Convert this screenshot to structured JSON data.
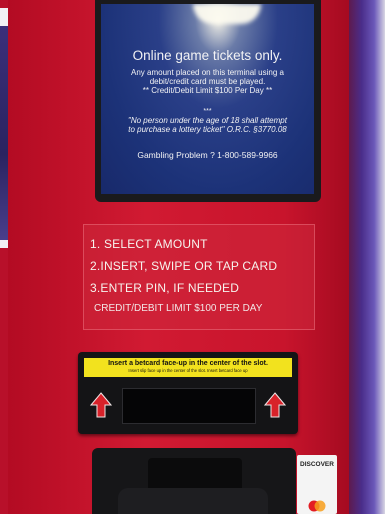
{
  "screen": {
    "title": "Online game tickets only.",
    "line1": "Any amount placed on this terminal using a",
    "line2": "debit/credit card must be played.",
    "line3": "** Credit/Debit Limit $100 Per Day **",
    "stars": "***",
    "line4": "\"No person under the age of 18 shall attempt",
    "line5": "to purchase a lottery ticket\" O.R.C. §3770.08",
    "help": "Gambling Problem ? 1-800-589-9966"
  },
  "instructions": {
    "step1": "1. SELECT AMOUNT",
    "step2": "2.INSERT, SWIPE OR TAP CARD",
    "step3": "3.ENTER PIN, IF NEEDED",
    "limit": "CREDIT/DEBIT LIMIT $100 PER DAY"
  },
  "reader": {
    "banner": "Insert a betcard face-up in the center of the slot.",
    "fine_print": "Insert slip face up in the center of the slot. Insert betcard face up"
  },
  "cards": {
    "discover": "DISCOVER"
  },
  "colors": {
    "cabinet": "#c8142c",
    "screen": "#1c3278",
    "banner": "#f2e21e",
    "arrow": "#d8222a"
  }
}
